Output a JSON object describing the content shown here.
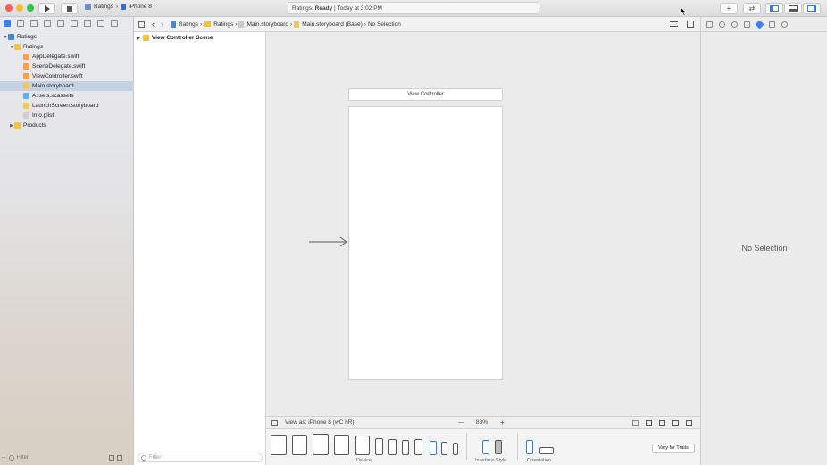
{
  "titlebar": {
    "scheme_project": "Ratings",
    "scheme_device": "iPhone 8",
    "status_project": "Ratings:",
    "status_state": "Ready",
    "status_time": "| Today at 3:02 PM"
  },
  "navigator": {
    "items": [
      {
        "label": "Ratings",
        "type": "project",
        "level": 0,
        "expanded": true
      },
      {
        "label": "Ratings",
        "type": "folder",
        "level": 1,
        "expanded": true
      },
      {
        "label": "AppDelegate.swift",
        "type": "swift",
        "level": 2
      },
      {
        "label": "SceneDelegate.swift",
        "type": "swift",
        "level": 2
      },
      {
        "label": "ViewController.swift",
        "type": "swift",
        "level": 2
      },
      {
        "label": "Main.storyboard",
        "type": "storyboard",
        "level": 2,
        "selected": true
      },
      {
        "label": "Assets.xcassets",
        "type": "assets",
        "level": 2
      },
      {
        "label": "LaunchScreen.storyboard",
        "type": "storyboard",
        "level": 2
      },
      {
        "label": "Info.plist",
        "type": "plist",
        "level": 2
      },
      {
        "label": "Products",
        "type": "folder",
        "level": 1,
        "expanded": false
      }
    ],
    "filter_placeholder": "Filter"
  },
  "jumpbar": {
    "crumbs": [
      "Ratings",
      "Ratings",
      "Main.storyboard",
      "Main.storyboard (Base)",
      "No Selection"
    ]
  },
  "outline": {
    "scene_label": "View Controller Scene",
    "filter_placeholder": "Filter"
  },
  "canvas": {
    "vc_title": "View Controller"
  },
  "viewas": {
    "label": "View as: iPhone 8 (wC hR)",
    "zoom_minus": "—",
    "zoom": "83%",
    "zoom_plus": "+"
  },
  "devicebar": {
    "device_label": "Device",
    "interface_label": "Interface Style",
    "orientation_label": "Orientation",
    "vary_label": "Vary for Traits"
  },
  "inspector": {
    "empty_text": "No Selection"
  }
}
